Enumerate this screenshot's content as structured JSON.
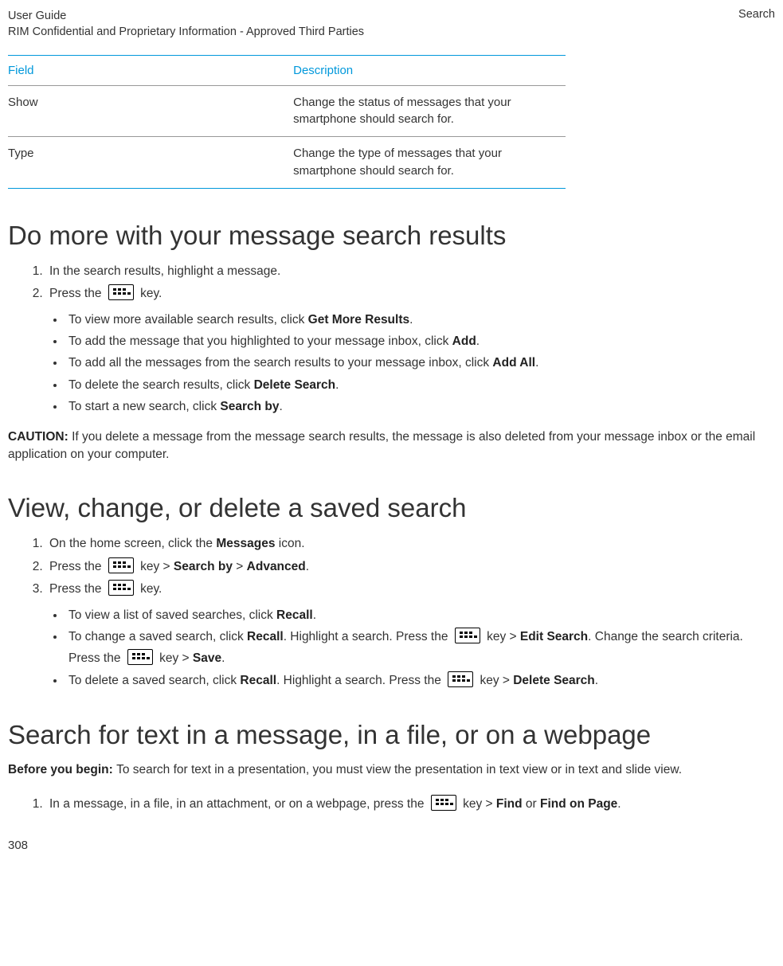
{
  "header": {
    "title": "User Guide",
    "subtitle": "RIM Confidential and Proprietary Information - Approved Third Parties",
    "section": "Search"
  },
  "table": {
    "col1": "Field",
    "col2": "Description",
    "rows": [
      {
        "field": "Show",
        "desc": "Change the status of messages that your smartphone should search for."
      },
      {
        "field": "Type",
        "desc": "Change the type of messages that your smartphone should search for."
      }
    ]
  },
  "sec1": {
    "heading": "Do more with your message search results",
    "step1": "In the search results, highlight a message.",
    "step2a": "Press the ",
    "step2b": " key.",
    "b1a": "To view more available search results, click ",
    "b1b": "Get More Results",
    "b1c": ".",
    "b2a": "To add the message that you highlighted to your message inbox, click ",
    "b2b": "Add",
    "b2c": ".",
    "b3a": "To add all the messages from the search results to your message inbox, click ",
    "b3b": "Add All",
    "b3c": ".",
    "b4a": "To delete the search results, click ",
    "b4b": "Delete Search",
    "b4c": ".",
    "b5a": "To start a new search, click ",
    "b5b": "Search by",
    "b5c": ".",
    "cautionLabel": "CAUTION: ",
    "cautionText": "If you delete a message from the message search results, the message is also deleted from your message inbox or the email application on your computer."
  },
  "sec2": {
    "heading": "View, change, or delete a saved search",
    "s1a": "On the home screen, click the ",
    "s1b": "Messages",
    "s1c": " icon.",
    "s2a": " Press the ",
    "s2b": " key > ",
    "s2c": "Search by",
    "s2d": " > ",
    "s2e": "Advanced",
    "s2f": ".",
    "s3a": "Press the ",
    "s3b": " key.",
    "b1a": "To view a list of saved searches, click ",
    "b1b": "Recall",
    "b1c": ".",
    "b2a": " To change a saved search, click ",
    "b2b": "Recall",
    "b2c": ". Highlight a search. Press the ",
    "b2d": " key > ",
    "b2e": "Edit Search",
    "b2f": ". Change the search criteria. Press the ",
    "b2g": " key > ",
    "b2h": "Save",
    "b2i": ".",
    "b3a": " To delete a saved search, click ",
    "b3b": "Recall",
    "b3c": ". Highlight a search. Press the ",
    "b3d": " key > ",
    "b3e": "Delete Search",
    "b3f": "."
  },
  "sec3": {
    "heading": "Search for text in a message, in a file, or on a webpage",
    "beforeLabel": "Before you begin: ",
    "beforeText": "To search for text in a presentation, you must view the presentation in text view or in text and slide view.",
    "s1a": "In a message, in a file, in an attachment, or on a webpage, press the ",
    "s1b": " key > ",
    "s1c": "Find",
    "s1d": " or ",
    "s1e": "Find on Page",
    "s1f": "."
  },
  "pageNumber": "308"
}
